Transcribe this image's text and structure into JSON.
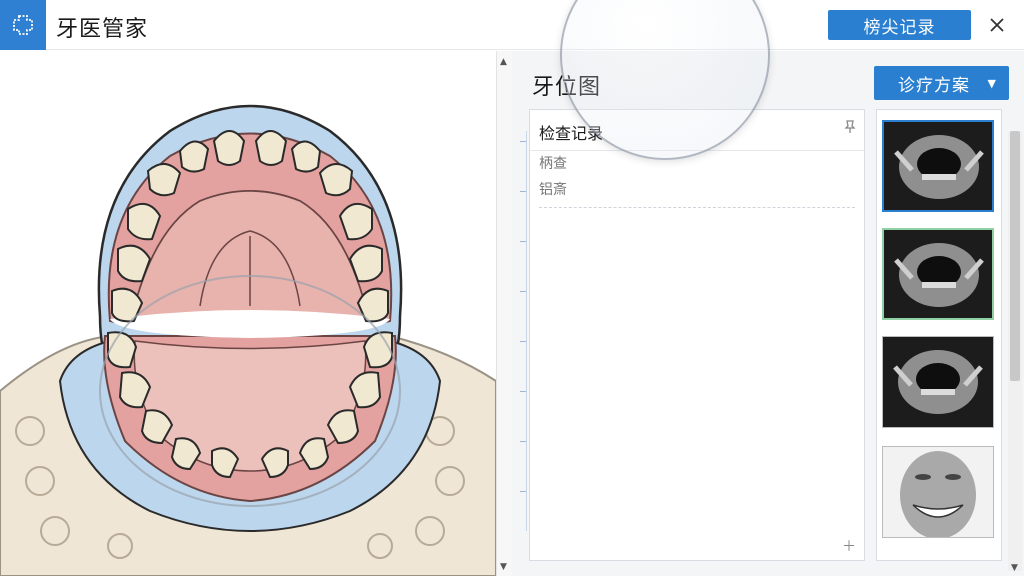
{
  "app": {
    "title": "牙医管家",
    "icon": "tooth-logo-icon"
  },
  "toolbar": {
    "submit_label": "榜尖记录",
    "close_icon": "close-icon"
  },
  "left_panel": {
    "illustration": "dental-arch-illustration"
  },
  "right_panel": {
    "title": "牙位图",
    "plan_button": "诊疗方案",
    "record": {
      "header": "检查记录",
      "items": [
        "柄查",
        "铝斎"
      ],
      "pin_icon": "pin-icon",
      "add_icon": "plus-icon"
    },
    "thumbnails": [
      {
        "kind": "intraoral-photo",
        "state": "selected"
      },
      {
        "kind": "intraoral-photo",
        "state": "hover"
      },
      {
        "kind": "intraoral-photo",
        "state": "normal"
      },
      {
        "kind": "face-smile-photo",
        "state": "normal"
      }
    ]
  },
  "colors": {
    "accent": "#2a7fd0",
    "gum": "#e3a2a0",
    "tooth": "#f1e8d2",
    "bone": "#efe6d6",
    "blue_tissue": "#bcd6ee"
  }
}
